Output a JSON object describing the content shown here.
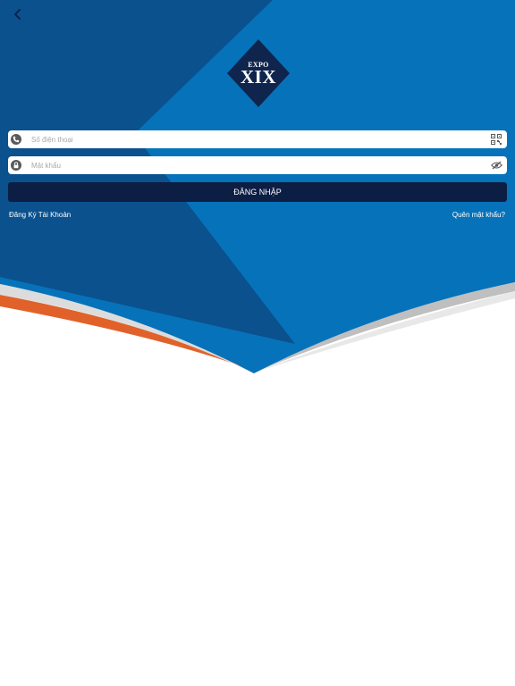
{
  "colors": {
    "dark_blue": "#0a518e",
    "light_blue": "#0672b9",
    "navy": "#0d1e44",
    "accent_orange": "#e0622a",
    "silver": "#b8b8b8"
  },
  "header": {
    "back_icon": "chevron-left-icon"
  },
  "logo": {
    "brand_top": "EXPO",
    "brand_main": "XIX"
  },
  "form": {
    "phone": {
      "placeholder": "Số điện thoại",
      "value": "",
      "icon": "phone-icon",
      "right_icon": "qr-code-icon"
    },
    "password": {
      "placeholder": "Mật khẩu",
      "value": "",
      "icon": "lock-icon",
      "right_icon": "eye-off-icon"
    },
    "login_label": "ĐĂNG NHẬP"
  },
  "links": {
    "register": "Đăng Ký Tài Khoản",
    "forgot": "Quên mật khẩu?"
  }
}
